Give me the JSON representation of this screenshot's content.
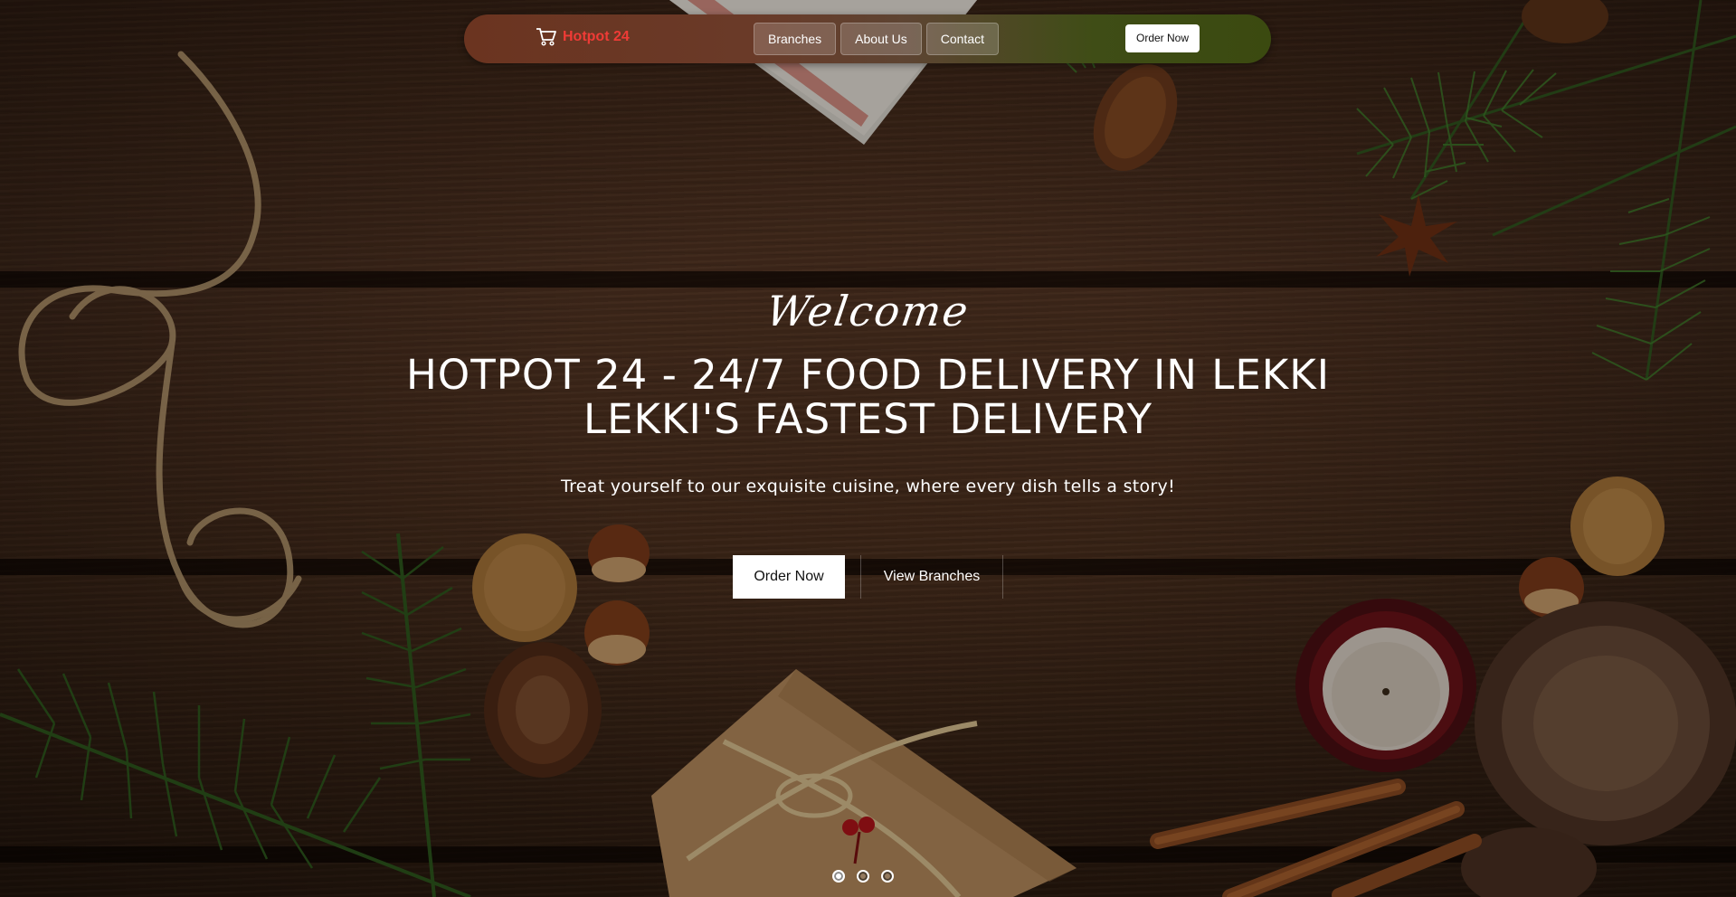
{
  "brand": {
    "name": "Hotpot 24",
    "icon": "cart-icon",
    "color": "#ef3b36"
  },
  "nav": {
    "links": [
      "Branches",
      "About Us",
      "Contact"
    ],
    "order_label": "Order Now"
  },
  "hero": {
    "welcome": "Welcome",
    "headline_line1": "HOTPOT 24 - 24/7 FOOD DELIVERY IN LEKKI",
    "headline_line2": "LEKKI'S FASTEST DELIVERY",
    "tagline": "Treat yourself to our exquisite cuisine, where every dish tells a story!",
    "primary_cta": "Order Now",
    "secondary_cta": "View Branches"
  },
  "carousel": {
    "slides": 3,
    "active_index": 0
  },
  "colors": {
    "navbar_left": "#6b3420",
    "navbar_right": "#3b4a10",
    "wood": "#4a2d1c"
  }
}
